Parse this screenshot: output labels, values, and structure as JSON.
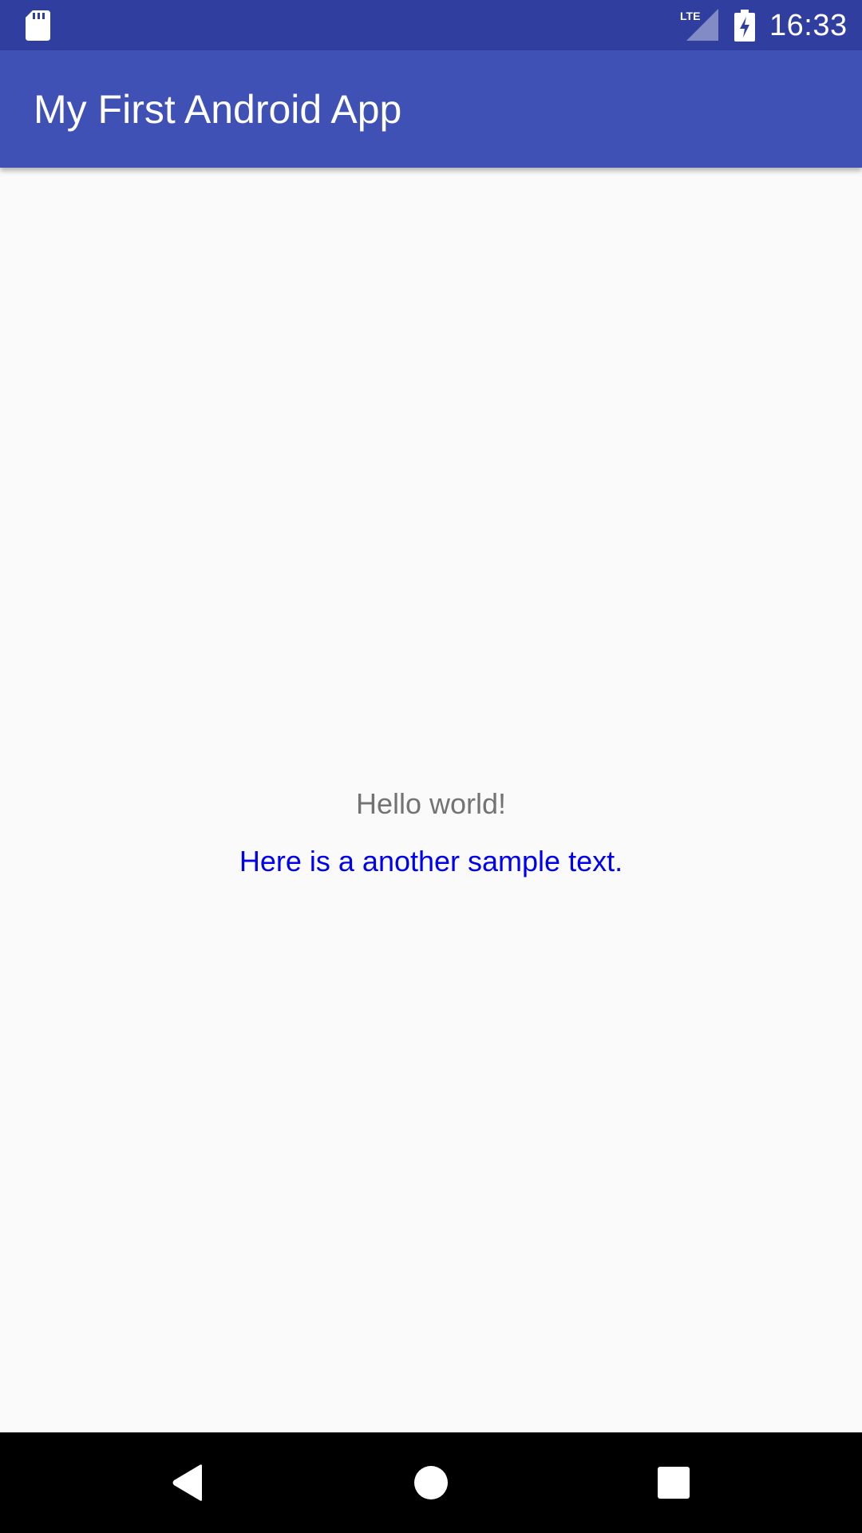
{
  "status_bar": {
    "time": "16:33",
    "network_label": "LTE",
    "icons": [
      "sd-card-icon",
      "lte-signal-icon",
      "battery-charging-icon"
    ],
    "background_color": "#303f9f"
  },
  "app_bar": {
    "title": "My First Android App",
    "background_color": "#3f51b5"
  },
  "content": {
    "hello_text": "Hello world!",
    "sample_text": "Here is a another sample text.",
    "hello_color": "#737373",
    "sample_color": "#0000ee"
  },
  "nav_bar": {
    "buttons": [
      "back-icon",
      "home-icon",
      "recents-icon"
    ]
  }
}
